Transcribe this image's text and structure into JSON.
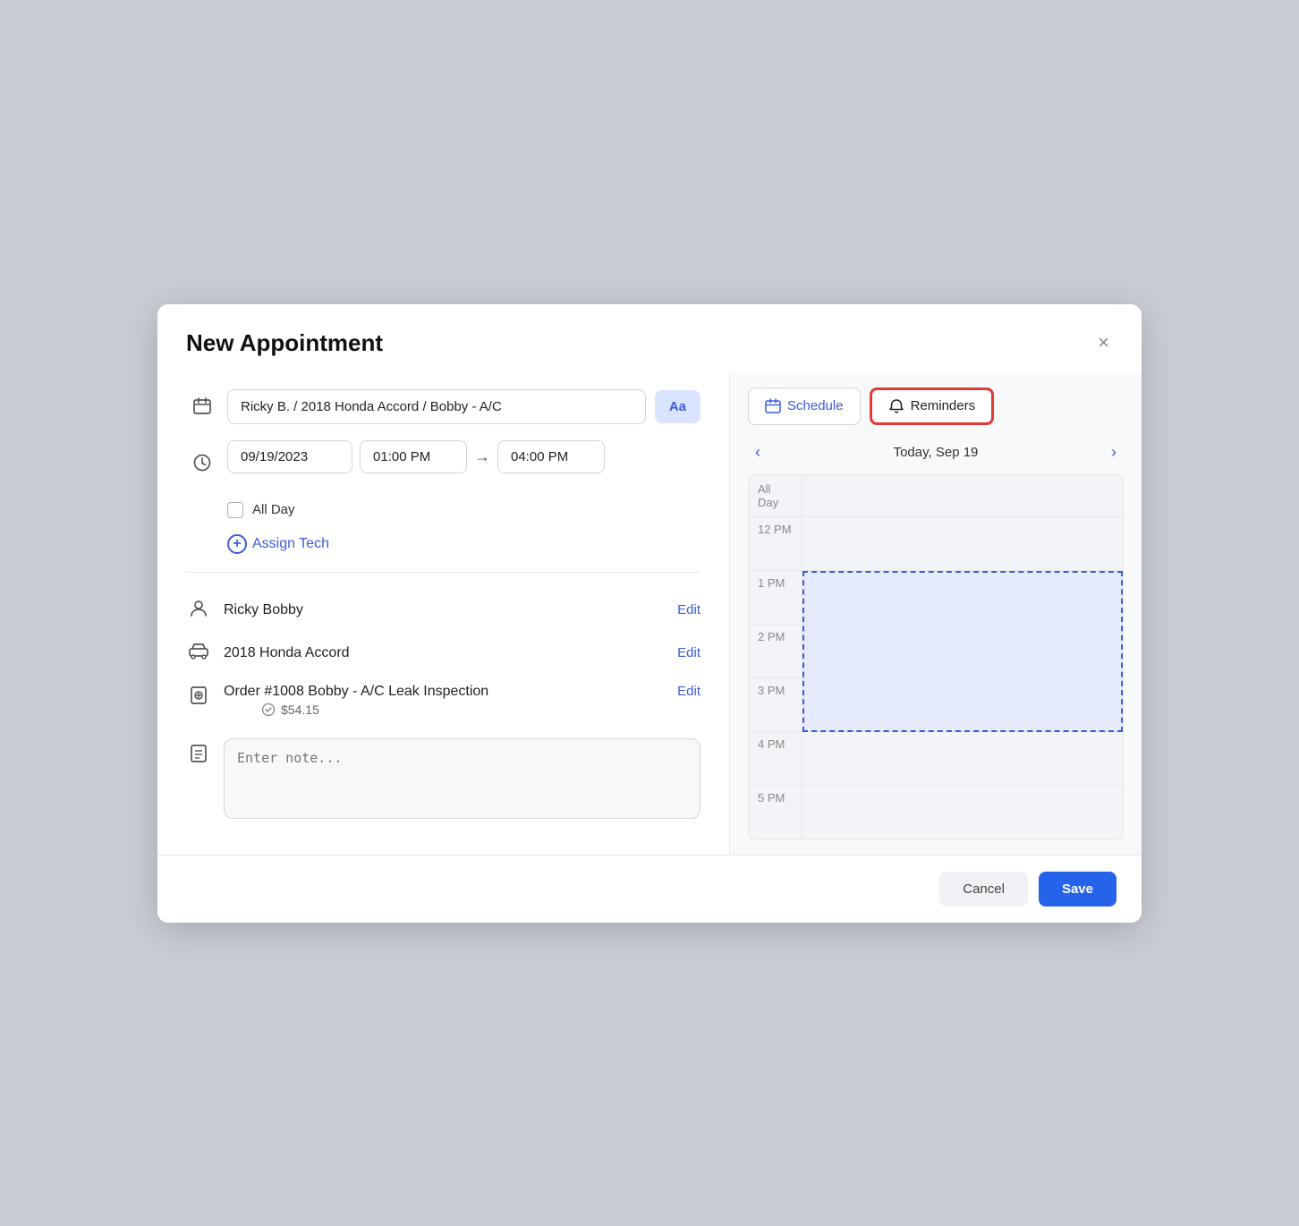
{
  "modal": {
    "title": "New Appointment",
    "close_label": "×"
  },
  "left": {
    "appointment_input": {
      "value": "Ricky B. / 2018 Honda Accord / Bobby - A/C",
      "placeholder": "Ricky B. / 2018 Honda Accord / Bobby - A/C"
    },
    "aa_button_label": "Aa",
    "date": "09/19/2023",
    "start_time": "01:00 PM",
    "end_time": "04:00 PM",
    "allday_label": "All Day",
    "assign_tech_label": "Assign Tech",
    "customer": {
      "name": "Ricky Bobby",
      "edit_label": "Edit"
    },
    "vehicle": {
      "name": "2018 Honda Accord",
      "edit_label": "Edit"
    },
    "order": {
      "name": "Order #1008 Bobby - A/C Leak Inspection",
      "amount": "$54.15",
      "edit_label": "Edit"
    },
    "note_placeholder": "Enter note..."
  },
  "right": {
    "schedule_label": "Schedule",
    "reminders_label": "Reminders",
    "nav_date": "Today, Sep 19",
    "allday_label": "All Day",
    "time_slots": [
      "12 PM",
      "1 PM",
      "2 PM",
      "3 PM",
      "4 PM",
      "5 PM"
    ]
  },
  "footer": {
    "cancel_label": "Cancel",
    "save_label": "Save"
  }
}
